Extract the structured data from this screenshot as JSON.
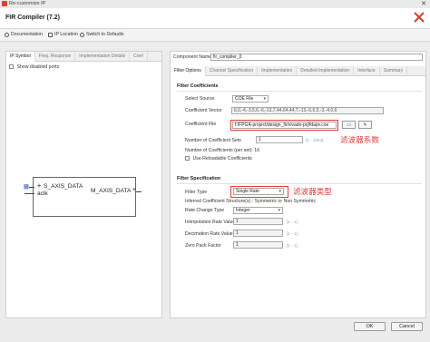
{
  "window": {
    "title": "Re-customize IP"
  },
  "header": {
    "title": "FIR Compiler (7.2)"
  },
  "toolbar": {
    "documentation": "Documentation",
    "ip_location": "IP Location",
    "switch_defaults": "Switch to Defaults"
  },
  "left": {
    "tabs": [
      "IP Symbol",
      "Freq. Response",
      "Implementation Details",
      "Coef"
    ],
    "show_disabled": "Show disabled ports",
    "ports": {
      "s_axis": "S_AXIS_DATA",
      "aclk": "aclk",
      "m_axis": "M_AXIS_DATA"
    }
  },
  "right": {
    "component_label": "Component Name",
    "component_value": "fir_compiler_0",
    "tabs": [
      "Filter Options",
      "Channel Specification",
      "Implementation",
      "Detailed Implementation",
      "Interface",
      "Summary"
    ],
    "coeff_section": "Filter Coefficients",
    "select_source_label": "Select Source",
    "select_source_value": "COE File",
    "coeff_vector_label": "Coefficient Vector",
    "coeff_vector_value": "6,0,-4,-3,5,6,-6,-13,7,44,64,44,7,-13,-6,6,5,-3,-4,0,6",
    "coeff_file_label": "Coefficient File",
    "coeff_file_value": "f:/FPGA-project/design_fir/vivado-prj/fdapv.coe",
    "num_sets_label": "Number of Coefficient Sets",
    "num_sets_value": "1",
    "num_sets_range": "[1 - 1024]",
    "num_per_set": "Number of Coefficients (per set): 16",
    "reloadable": "Use Reloadable Coefficients",
    "filter_section": "Filter Specification",
    "filter_type_label": "Filter Type",
    "filter_type_value": "Single Rate",
    "inferred": "Inferred Coefficient Structure(s) : Symmetric or Non Symmetric",
    "rate_change_label": "Rate Change Type",
    "rate_change_value": "Integer",
    "interp_label": "Interpolation Rate Value",
    "interp_value": "1",
    "interp_range": "[1 - 1]",
    "decim_label": "Decimation Rate Value",
    "decim_value": "1",
    "decim_range": "[1 - 1]",
    "zero_pack_label": "Zero Pack Factor",
    "zero_pack_value": "1",
    "zero_pack_range": "[1 - 1]"
  },
  "annotations": {
    "coeff": "滤波器系数",
    "filter_type": "滤波器类型"
  },
  "buttons": {
    "ok": "OK",
    "cancel": "Cancel"
  },
  "colors": {
    "annotation": "#e23b3b",
    "brand": "#d6452f"
  }
}
